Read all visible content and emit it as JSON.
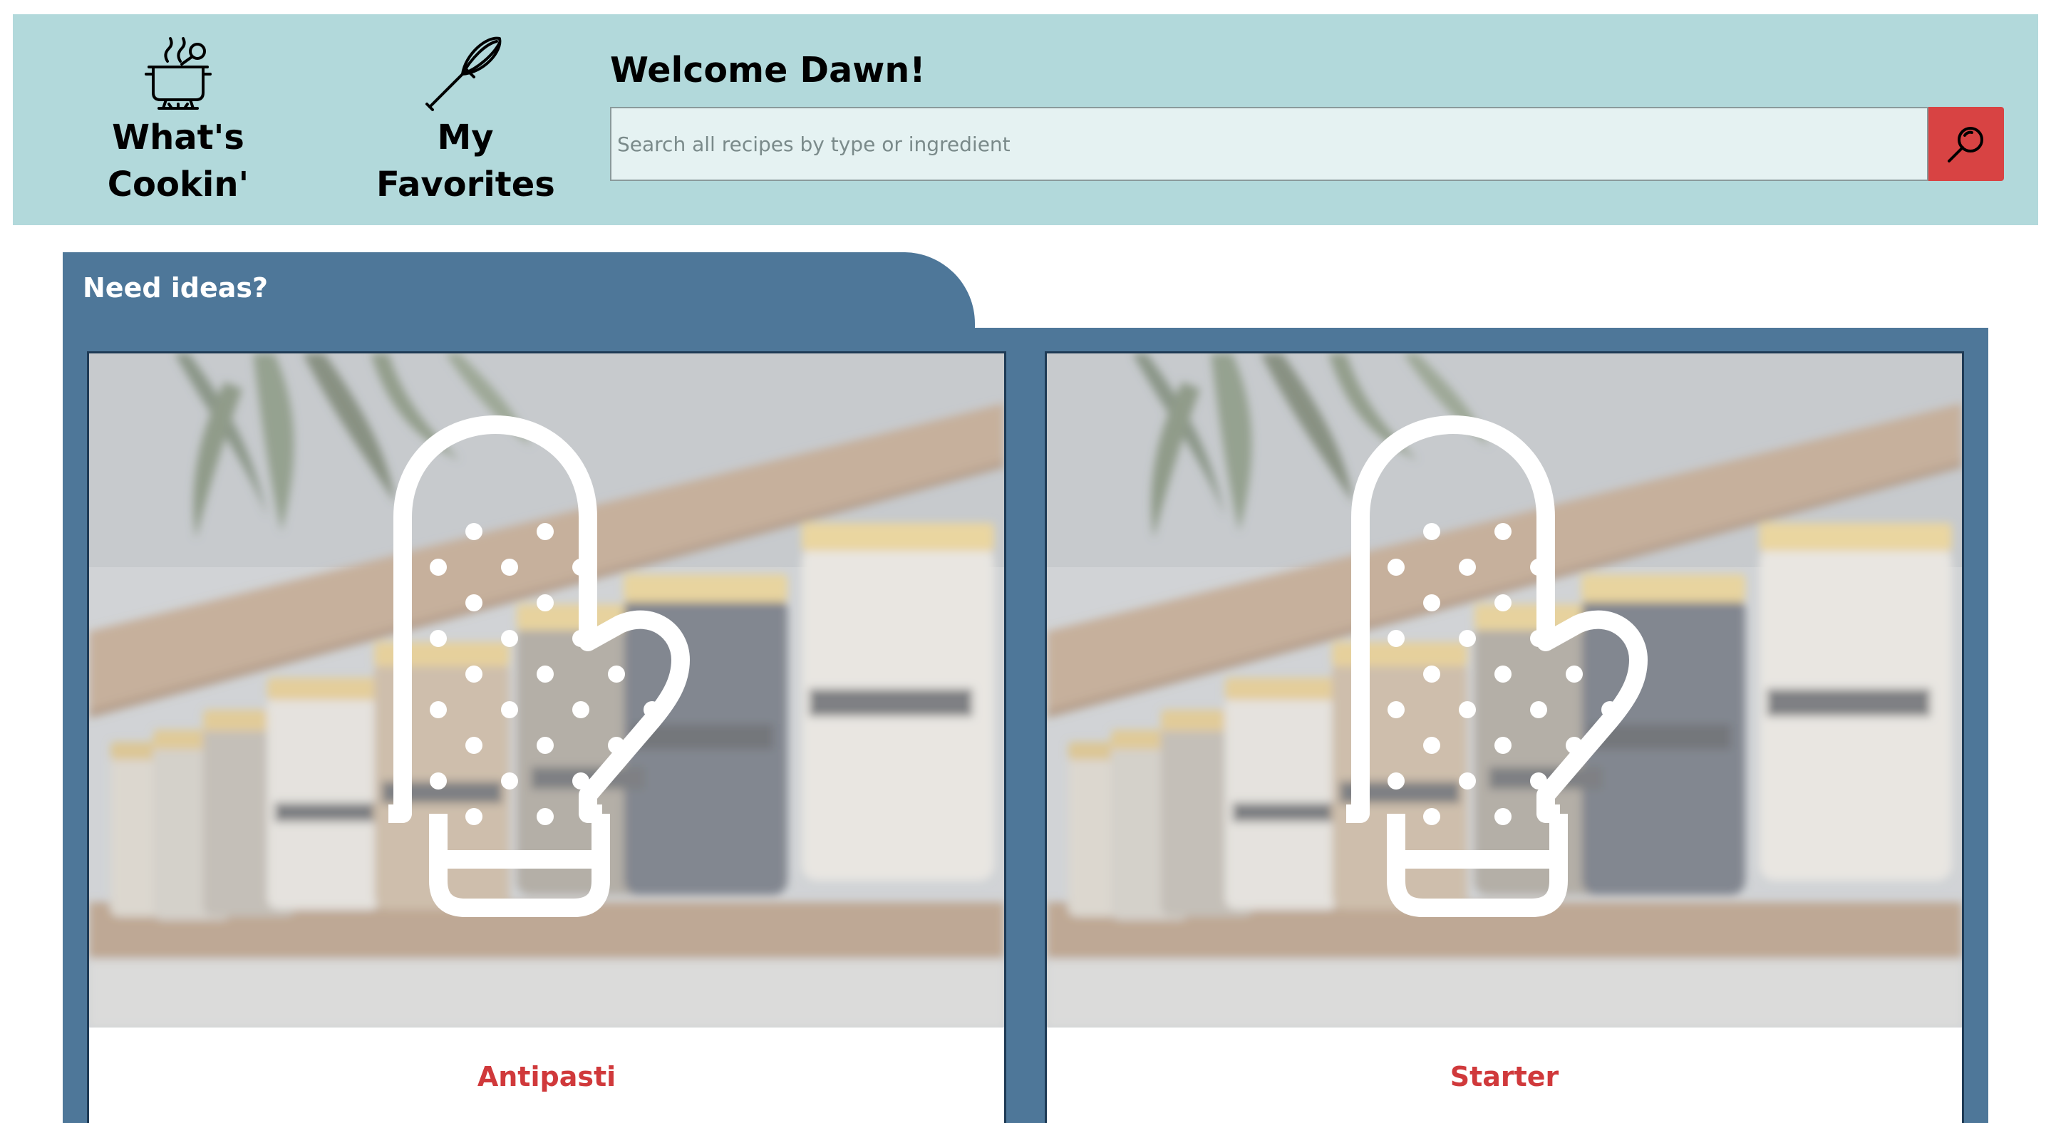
{
  "header": {
    "nav": [
      {
        "label": "What's Cookin'",
        "icon": "cooking-pot-icon"
      },
      {
        "label": "My Favorites",
        "icon": "whisk-icon"
      }
    ],
    "welcome": "Welcome Dawn!",
    "search": {
      "placeholder": "Search all recipes by type or ingredient",
      "value": "",
      "button_icon": "search-icon"
    }
  },
  "ideas": {
    "tab_label": "Need ideas?",
    "cards": [
      {
        "title": "Antipasti",
        "image": "spice-jars-shelf-with-oven-mitt-icon"
      },
      {
        "title": "Starter",
        "image": "spice-jars-shelf-with-oven-mitt-icon"
      }
    ]
  },
  "colors": {
    "header_bg": "#b2d9db",
    "panel_bg": "#4e7799",
    "search_button": "#d84343",
    "card_title": "#d0393b"
  }
}
